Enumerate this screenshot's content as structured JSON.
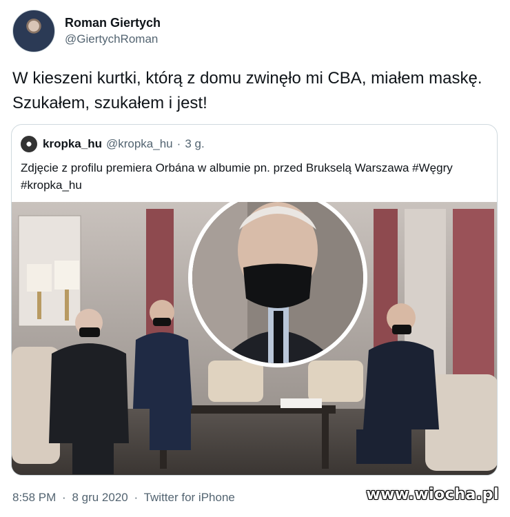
{
  "tweet": {
    "display_name": "Roman Giertych",
    "handle": "@GiertychRoman",
    "text": "W kieszeni kurtki, którą z domu zwinęło mi CBA, miałem maskę. Szukałem, szukałem i jest!"
  },
  "quoted_tweet": {
    "display_name": "kropka_hu",
    "handle": "@kropka_hu",
    "separator": "·",
    "time_ago": "3 g.",
    "text": "Zdjęcie z profilu premiera Orbána w albumie pn. przed Brukselą Warszawa #Węgry #kropka_hu"
  },
  "footer": {
    "time": "8:58 PM",
    "separator": "·",
    "date": "8 gru 2020",
    "separator2": "·",
    "source": "Twitter for iPhone"
  },
  "watermark": "www.wiocha.pl"
}
